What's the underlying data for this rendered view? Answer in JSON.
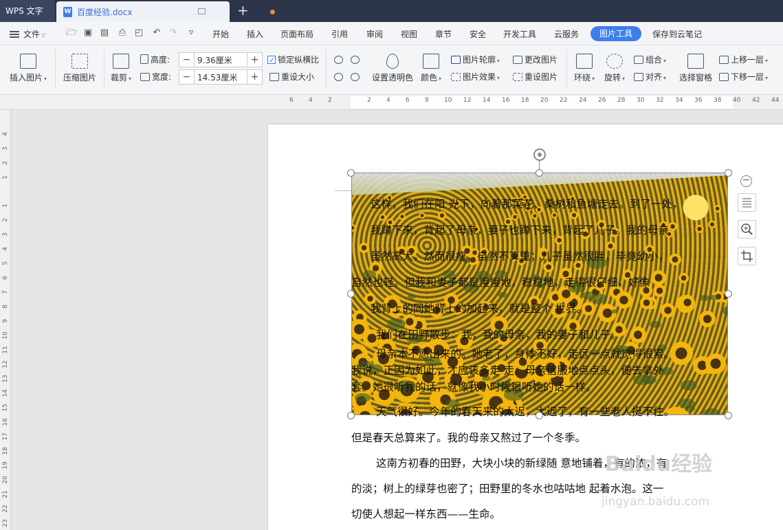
{
  "titlebar": {
    "app_name": "WPS 文字",
    "doc_tab": "百度经验.docx",
    "doc_icon_letter": "W",
    "new_tab": "+",
    "unsaved_color": "#f28a3a"
  },
  "menubar": {
    "file_label": "文件",
    "items": [
      "开始",
      "插入",
      "页面布局",
      "引用",
      "审阅",
      "视图",
      "章节",
      "安全",
      "开发工具",
      "云服务",
      "图片工具",
      "保存到云笔记"
    ],
    "active_item": "图片工具",
    "accent_color": "#3d7eea"
  },
  "ribbon": {
    "insert_picture": "插入图片",
    "compress_picture": "压缩图片",
    "crop": "裁剪",
    "height_label": "高度:",
    "height_value": "9.36厘米",
    "width_label": "宽度:",
    "width_value": "14.53厘米",
    "lock_ratio": "锁定纵横比",
    "lock_ratio_checked": true,
    "reset_size": "重设大小",
    "set_transparent": "设置透明色",
    "color": "颜色",
    "picture_outline": "图片轮廓",
    "picture_effects": "图片效果",
    "change_picture": "更改图片",
    "reset_picture": "重设图片",
    "wrap": "环绕",
    "rotate": "旋转",
    "group": "组合",
    "align": "对齐",
    "selection_pane": "选择窗格",
    "bring_forward": "上移一层",
    "send_backward": "下移一层"
  },
  "ruler": {
    "h_ticks": [
      "6",
      "4",
      "2",
      "2",
      "4",
      "6",
      "8",
      "10",
      "12",
      "14",
      "16",
      "18",
      "20",
      "22",
      "24",
      "26",
      "28",
      "30",
      "32",
      "34",
      "36",
      "38",
      "40",
      "42",
      "44"
    ],
    "v_ticks": [
      "4",
      "3",
      "2",
      "1",
      "1",
      "2",
      "3",
      "4",
      "5",
      "6",
      "7",
      "8",
      "9",
      "10",
      "11",
      "12",
      "13",
      "14",
      "15",
      "16",
      "17",
      "18",
      "19",
      "20",
      "21",
      "22",
      "23"
    ]
  },
  "document": {
    "lines": [
      "这样，我们在阳 光下，向着那菜花、桑树和鱼塘走去。到了一处，",
      "我蹲下来，背起了母亲，妻子也蹲下来，背起了儿子。我的母亲",
      "虽然高大，然而很瘦，自然不算重；儿子虽然很胖，毕竟幼小，",
      "自然也轻。但我和妻子都是慢慢地，稳稳地，走得很仔细，好像",
      "我背上的同她背上的加起来，就是整个 世界。",
      "我们在田野散步：我，我的母亲，我的妻子和儿子。",
      "母亲本不愿出来的。她老了，身体不好，走远一点就觉得很累。",
      "我说，正因为如此，才应该多走 走。母亲信服地点点头，便去拿外",
      "套。她很听我的话，就像我小时候很听她的话一样。",
      "天气很好。今年的春天来的太迟，太迟了，有一些老人挺不住。",
      "但是春天总算来了。我的母亲又熬过了一个冬季。",
      "这南方初春的田野，大块小块的新绿随 意地铺着，有的浓，有",
      "的淡；树上的绿芽也密了；田野里的冬水也咕咕地 起着水泡。这一",
      "切使人想起一样东西——生命。"
    ],
    "watermark": "Baidu经验",
    "watermark_url": "jingyan.baidu.com"
  }
}
